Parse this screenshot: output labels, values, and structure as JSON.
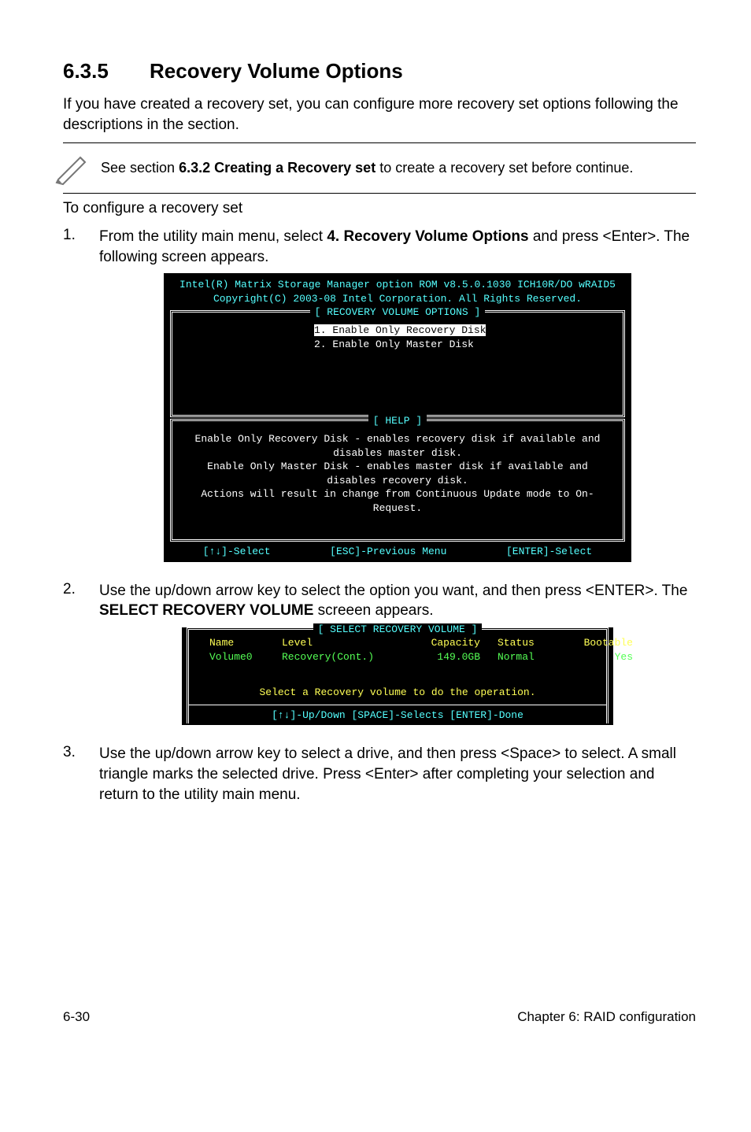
{
  "heading": {
    "number": "6.3.5",
    "title": "Recovery Volume Options"
  },
  "intro": "If you have created a recovery set, you can configure more recovery set options following the descriptions in the section.",
  "note": {
    "prefix": "See section ",
    "bold": "6.3.2 Creating a Recovery set",
    "suffix": " to create a recovery set before continue."
  },
  "pre_steps": "To configure a recovery set",
  "step1": {
    "num": "1.",
    "text_a": "From the utility main menu, select ",
    "text_bold": "4. Recovery Volume Options",
    "text_b": " and press <Enter>. The following screen appears."
  },
  "term1": {
    "header_l1": "Intel(R) Matrix Storage Manager option ROM v8.5.0.1030 ICH10R/DO wRAID5",
    "header_l2": "Copyright(C) 2003-08 Intel Corporation.  All Rights Reserved.",
    "box1_title": "[ RECOVERY VOLUME OPTIONS ]",
    "opt1": "1.  Enable Only Recovery Disk ",
    "opt2": "2.  Enable Only Master Disk",
    "box2_title": "[ HELP ]",
    "help_l1": "Enable Only Recovery Disk - enables recovery disk if available and",
    "help_l2": "disables master disk.",
    "help_l3": "Enable Only Master Disk - enables master disk if available and",
    "help_l4": "disables recovery disk.",
    "help_l5": "Actions will result in change from Continuous Update mode to On-Request.",
    "foot_a": "[↑↓]-Select",
    "foot_b": "[ESC]-Previous Menu",
    "foot_c": "[ENTER]-Select"
  },
  "step2": {
    "num": "2.",
    "text_a": "Use the up/down arrow key to select the option you want, and then press <ENTER>. The ",
    "text_bold": "SELECT RECOVERY VOLUME",
    "text_b": " screeen appears."
  },
  "term2": {
    "title": "[ SELECT RECOVERY VOLUME ]",
    "cols": {
      "name": "Name",
      "level": "Level",
      "capacity": "Capacity",
      "status": "Status",
      "bootable": "Bootable"
    },
    "row": {
      "name": "Volume0",
      "level": "Recovery(Cont.)",
      "capacity": "149.0GB",
      "status": "Normal",
      "bootable": "Yes"
    },
    "prompt": "Select a Recovery volume to do the operation.",
    "footer": "[↑↓]-Up/Down [SPACE]-Selects [ENTER]-Done"
  },
  "step3": {
    "num": "3.",
    "text": "Use the up/down arrow key to select a drive, and then press <Space> to select. A small triangle marks the selected drive. Press <Enter> after completing your selection and return to the utility main menu."
  },
  "footer": {
    "left": "6-30",
    "right": "Chapter 6: RAID configuration"
  }
}
